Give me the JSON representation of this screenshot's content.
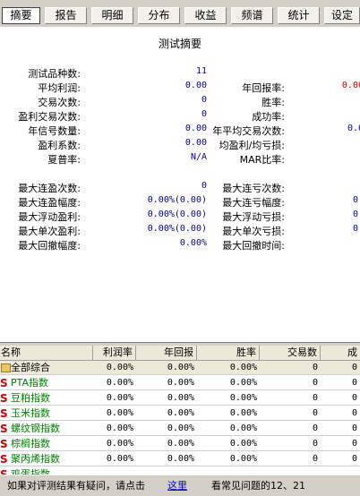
{
  "tabs": [
    "摘要",
    "报告",
    "明细",
    "分布",
    "收益",
    "频谱",
    "统计",
    "设定"
  ],
  "summary": {
    "title": "测试摘要",
    "left_block1": [
      {
        "label": "测试品种数:",
        "value": "11"
      },
      {
        "label": "平均利润:",
        "value": "0.00"
      },
      {
        "label": "交易次数:",
        "value": "0"
      },
      {
        "label": "盈利交易次数:",
        "value": "0"
      },
      {
        "label": "年信号数量:",
        "value": "0.00"
      },
      {
        "label": "盈利系数:",
        "value": "0.00"
      },
      {
        "label": "夏普率:",
        "value": "N/A"
      }
    ],
    "right_block1": [
      {
        "label": "年回报率:",
        "value": "0.00"
      },
      {
        "label": "胜率:",
        "value": ""
      },
      {
        "label": "成功率:",
        "value": ""
      },
      {
        "label": "年平均交易次数:",
        "value": "0.0"
      },
      {
        "label": "均盈利/均亏损:",
        "value": ""
      },
      {
        "label": "MAR比率:",
        "value": ""
      }
    ],
    "left_block2": [
      {
        "label": "最大连盈次数:",
        "value": "0"
      },
      {
        "label": "最大连盈幅度:",
        "value": "0.00%(0.00)"
      },
      {
        "label": "最大浮动盈利:",
        "value": "0.00%(0.00)"
      },
      {
        "label": "最大单次盈利:",
        "value": "0.00%(0.00)"
      },
      {
        "label": "最大回撤幅度:",
        "value": "0.00%"
      }
    ],
    "right_block2": [
      {
        "label": "最大连亏次数:",
        "value": ""
      },
      {
        "label": "最大连亏幅度:",
        "value": "0."
      },
      {
        "label": "最大浮动亏损:",
        "value": "0."
      },
      {
        "label": "最大单次亏损:",
        "value": "0."
      },
      {
        "label": "最大回撤时间:",
        "value": ""
      }
    ]
  },
  "table": {
    "headers": [
      "名称",
      "利润率",
      "年回报",
      "胜率",
      "交易数",
      "成"
    ],
    "rows": [
      {
        "name": "全部综合",
        "icon": "folder-icon",
        "cells": [
          "0.00%",
          "0.00%",
          "0.00%",
          "0",
          "0"
        ]
      },
      {
        "name": "PTA指数",
        "icon": "s-icon",
        "cells": [
          "0.00%",
          "0.00%",
          "0.00%",
          "0",
          "0"
        ]
      },
      {
        "name": "豆粕指数",
        "icon": "s-icon",
        "cells": [
          "0.00%",
          "0.00%",
          "0.00%",
          "0",
          "0"
        ]
      },
      {
        "name": "玉米指数",
        "icon": "s-icon",
        "cells": [
          "0.00%",
          "0.00%",
          "0.00%",
          "0",
          "0"
        ]
      },
      {
        "name": "螺纹钢指数",
        "icon": "s-icon",
        "cells": [
          "0.00%",
          "0.00%",
          "0.00%",
          "0",
          "0"
        ]
      },
      {
        "name": "棕榈指数",
        "icon": "s-icon",
        "cells": [
          "0.00%",
          "0.00%",
          "0.00%",
          "0",
          "0"
        ]
      },
      {
        "name": "聚丙烯指数",
        "icon": "s-icon",
        "cells": [
          "0.00%",
          "0.00%",
          "0.00%",
          "0",
          "0"
        ]
      },
      {
        "name": "鸡蛋指数",
        "icon": "s-icon",
        "cells": [
          "",
          "",
          "",
          "",
          ""
        ]
      }
    ]
  },
  "status": {
    "prefix": "如果对评测结果有疑问，请点击",
    "link": "这里",
    "suffix": "看常见问题的12、21"
  },
  "colors": {
    "accent_value": "#0000a0",
    "row_name_green": "#008000",
    "s_icon_red": "#d00000"
  }
}
